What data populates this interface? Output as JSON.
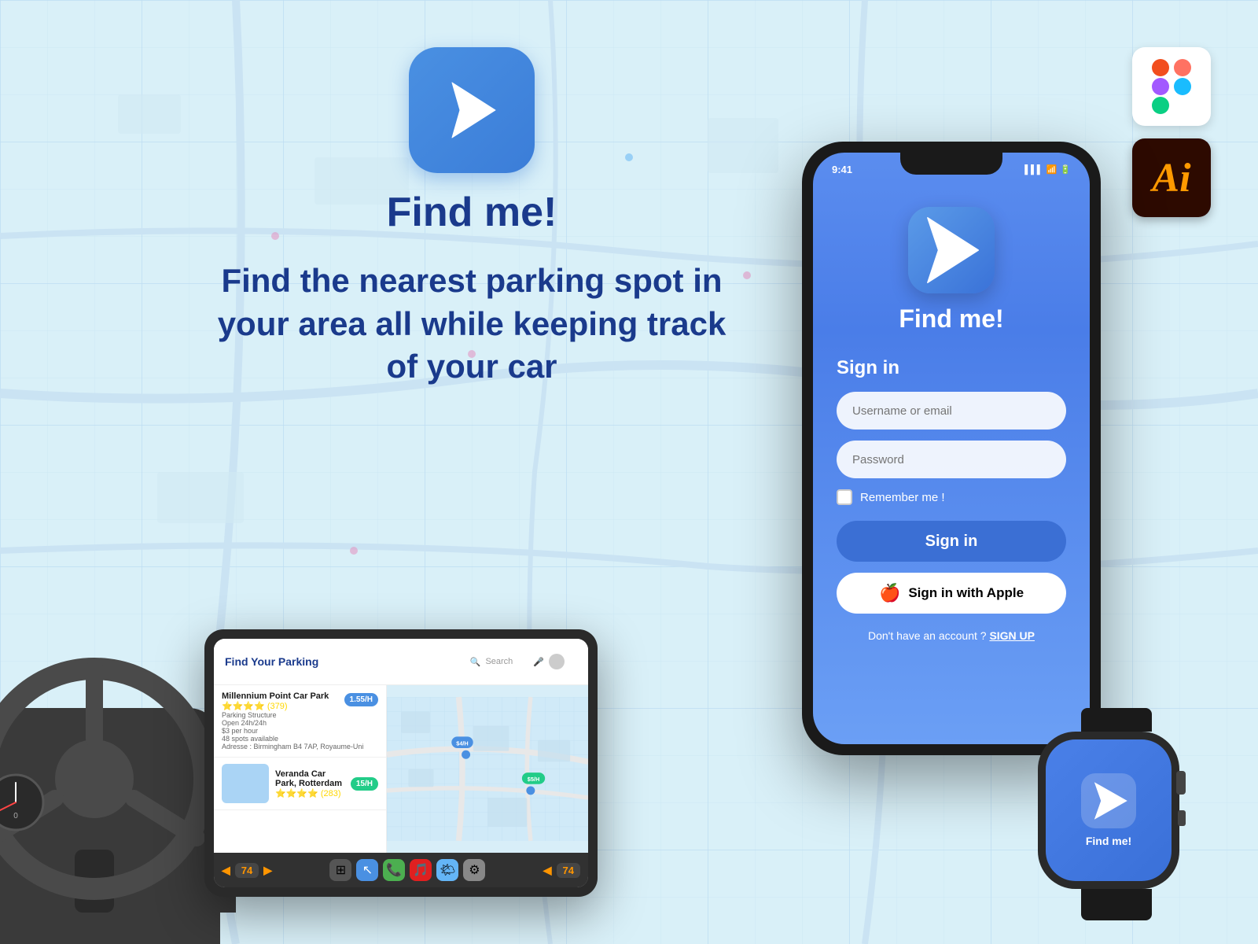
{
  "app": {
    "name": "Find me!",
    "tagline": "Find the nearest parking spot in your area all while keeping track of your car"
  },
  "phone": {
    "time": "9:41",
    "signin_title": "Sign in",
    "username_placeholder": "Username or email",
    "password_placeholder": "Password",
    "remember_label": "Remember me !",
    "signin_button": "Sign in",
    "apple_signin": "Sign in with Apple",
    "no_account_text": "Don't have an account ?",
    "signup_link": "SIGN UP"
  },
  "ipad": {
    "title": "Find Your Parking",
    "search_placeholder": "Search",
    "parking_items": [
      {
        "name": "Millennium Point Car Park",
        "type": "Parking Structure",
        "hours": "Open 24h/24h",
        "rate": "$3 per hour",
        "spots": "48 spots available",
        "address": "Addresse : Birmingham B4 7AP, Royaume-Uni",
        "rating": "4.0",
        "price": "1.55/H"
      },
      {
        "name": "Veranda Car Park, Rotterdam",
        "rating": "4.0",
        "price": "15/H"
      }
    ],
    "taskbar_number": "74"
  },
  "watch": {
    "title": "Find me!"
  },
  "tools": {
    "figma_label": "Figma",
    "ai_label": "Ai"
  }
}
